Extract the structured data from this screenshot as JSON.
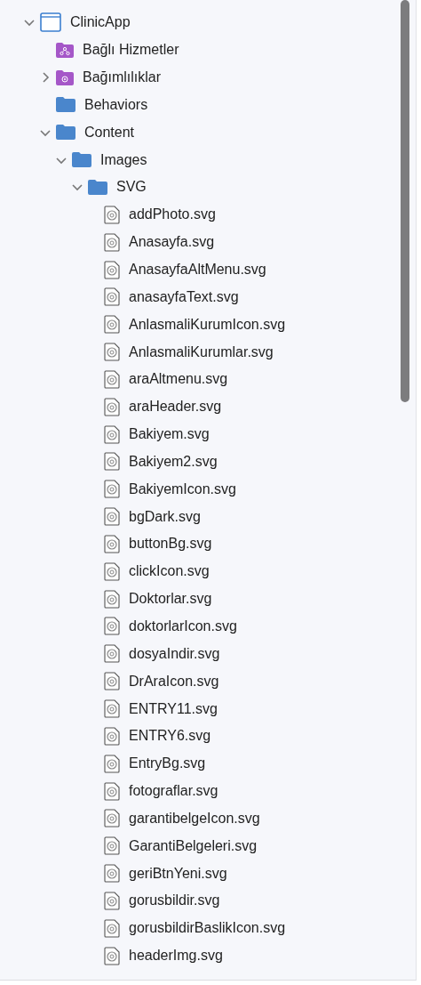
{
  "tree": [
    {
      "label": "ClinicApp",
      "kind": "project",
      "expanded": true,
      "children": [
        {
          "label": "Bağlı Hizmetler",
          "kind": "services"
        },
        {
          "label": "Bağımlılıklar",
          "kind": "packages",
          "expanded": false
        },
        {
          "label": "Behaviors",
          "kind": "folder"
        },
        {
          "label": "Content",
          "kind": "folder",
          "expanded": true,
          "children": [
            {
              "label": "Images",
              "kind": "folder",
              "expanded": true,
              "children": [
                {
                  "label": "SVG",
                  "kind": "folder",
                  "expanded": true,
                  "children": [
                    {
                      "label": "addPhoto.svg",
                      "kind": "file"
                    },
                    {
                      "label": "Anasayfa.svg",
                      "kind": "file"
                    },
                    {
                      "label": "AnasayfaAltMenu.svg",
                      "kind": "file"
                    },
                    {
                      "label": "anasayfaText.svg",
                      "kind": "file"
                    },
                    {
                      "label": "AnlasmaliKurumIcon.svg",
                      "kind": "file"
                    },
                    {
                      "label": "AnlasmaliKurumlar.svg",
                      "kind": "file"
                    },
                    {
                      "label": "araAltmenu.svg",
                      "kind": "file"
                    },
                    {
                      "label": "araHeader.svg",
                      "kind": "file"
                    },
                    {
                      "label": "Bakiyem.svg",
                      "kind": "file"
                    },
                    {
                      "label": "Bakiyem2.svg",
                      "kind": "file"
                    },
                    {
                      "label": "BakiyemIcon.svg",
                      "kind": "file"
                    },
                    {
                      "label": "bgDark.svg",
                      "kind": "file"
                    },
                    {
                      "label": "buttonBg.svg",
                      "kind": "file"
                    },
                    {
                      "label": "clickIcon.svg",
                      "kind": "file"
                    },
                    {
                      "label": "Doktorlar.svg",
                      "kind": "file"
                    },
                    {
                      "label": "doktorlarIcon.svg",
                      "kind": "file"
                    },
                    {
                      "label": "dosyaIndir.svg",
                      "kind": "file"
                    },
                    {
                      "label": "DrAraIcon.svg",
                      "kind": "file"
                    },
                    {
                      "label": "ENTRY11.svg",
                      "kind": "file"
                    },
                    {
                      "label": "ENTRY6.svg",
                      "kind": "file"
                    },
                    {
                      "label": "EntryBg.svg",
                      "kind": "file"
                    },
                    {
                      "label": "fotograflar.svg",
                      "kind": "file"
                    },
                    {
                      "label": "garantibelgeIcon.svg",
                      "kind": "file"
                    },
                    {
                      "label": "GarantiBelgeleri.svg",
                      "kind": "file"
                    },
                    {
                      "label": "geriBtnYeni.svg",
                      "kind": "file"
                    },
                    {
                      "label": "gorusbildir.svg",
                      "kind": "file"
                    },
                    {
                      "label": "gorusbildirBaslikIcon.svg",
                      "kind": "file"
                    },
                    {
                      "label": "headerImg.svg",
                      "kind": "file"
                    }
                  ]
                }
              ]
            }
          ]
        }
      ]
    }
  ]
}
